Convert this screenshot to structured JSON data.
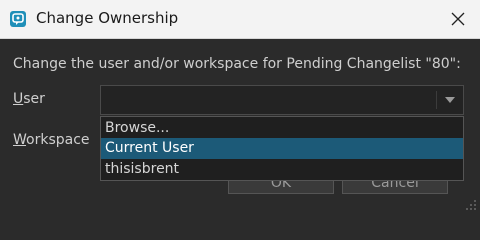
{
  "window": {
    "title": "Change Ownership",
    "close_icon": "close-icon",
    "app_icon": "perforce-app-icon"
  },
  "dialog": {
    "prompt": "Change the user and/or workspace for Pending Changelist \"80\":",
    "user_label_mnemonic": "U",
    "user_label_rest": "ser",
    "workspace_label_mnemonic": "W",
    "workspace_label_rest": "orkspace",
    "user_combo": {
      "value": "",
      "options": [
        "Browse...",
        "Current User",
        "thisisbrent"
      ],
      "highlighted": "Current User"
    },
    "ok_label": "OK",
    "cancel_label": "Cancel"
  },
  "colors": {
    "accent": "#1c5a78",
    "background": "#2b2b2b",
    "titlebar": "#f3f3f3"
  }
}
